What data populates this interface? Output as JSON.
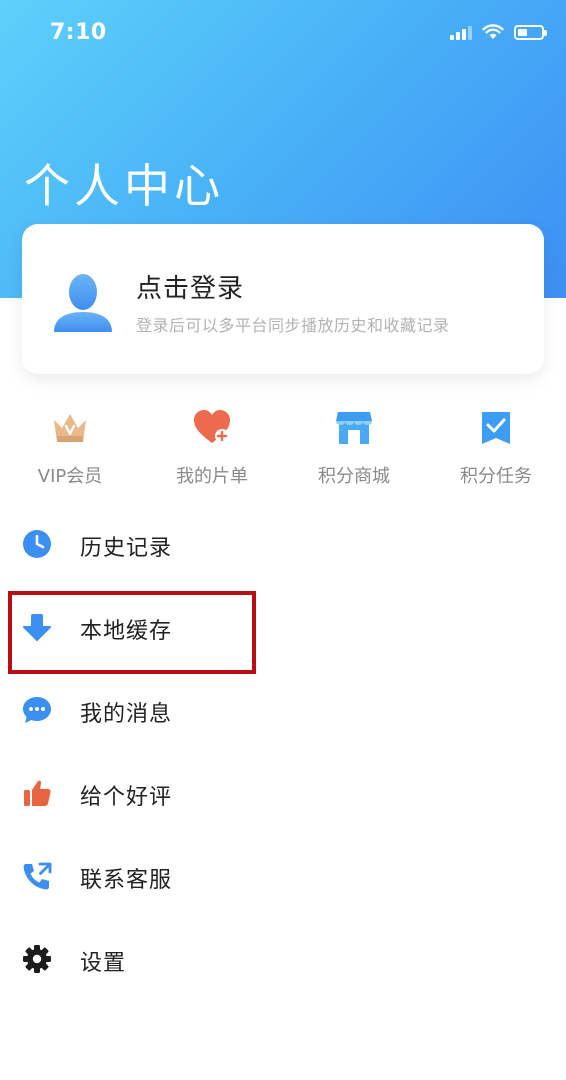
{
  "status_bar": {
    "time": "7:10"
  },
  "header": {
    "title": "个人中心"
  },
  "login_card": {
    "title": "点击登录",
    "subtitle": "登录后可以多平台同步播放历史和收藏记录"
  },
  "quick_actions": [
    {
      "label": "VIP会员",
      "icon": "crown-icon"
    },
    {
      "label": "我的片单",
      "icon": "heart-plus-icon"
    },
    {
      "label": "积分商城",
      "icon": "store-icon"
    },
    {
      "label": "积分任务",
      "icon": "task-check-icon"
    }
  ],
  "menu": [
    {
      "label": "历史记录",
      "icon": "clock-icon"
    },
    {
      "label": "本地缓存",
      "icon": "download-icon"
    },
    {
      "label": "我的消息",
      "icon": "message-icon"
    },
    {
      "label": "给个好评",
      "icon": "thumbs-up-icon"
    },
    {
      "label": "联系客服",
      "icon": "phone-icon"
    },
    {
      "label": "设置",
      "icon": "gear-icon"
    }
  ],
  "colors": {
    "header_gradient_start": "#5ed0fa",
    "header_gradient_end": "#3d8ff3",
    "accent_blue": "#3a8ff0",
    "highlight_red": "#b80f14"
  }
}
